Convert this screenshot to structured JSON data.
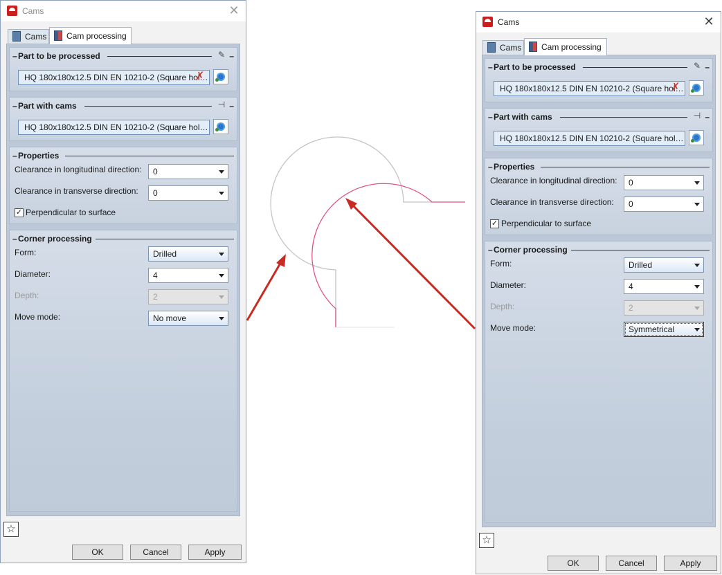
{
  "dialogs": [
    {
      "title": "Cams",
      "tabs": [
        "Cams",
        "Cam processing"
      ],
      "part_to_be_processed": {
        "title": "Part to be processed",
        "value": "HQ 180x180x12.5 DIN EN 10210-2 (Square hollo..."
      },
      "part_with_cams": {
        "title": "Part with cams",
        "value": "HQ 180x180x12.5 DIN EN 10210-2 (Square hollo..."
      },
      "properties": {
        "title": "Properties",
        "clearance_longitudinal_label": "Clearance in longitudinal direction:",
        "clearance_longitudinal": "0",
        "clearance_transverse_label": "Clearance in transverse direction:",
        "clearance_transverse": "0",
        "perpendicular_label": "Perpendicular to surface",
        "perpendicular_checked": "✓"
      },
      "corner": {
        "title": "Corner processing",
        "form_label": "Form:",
        "form": "Drilled",
        "diameter_label": "Diameter:",
        "diameter": "4",
        "depth_label": "Depth:",
        "depth": "2",
        "move_mode_label": "Move mode:",
        "move_mode": "No move"
      },
      "buttons": {
        "ok": "OK",
        "cancel": "Cancel",
        "apply": "Apply"
      }
    },
    {
      "title": "Cams",
      "tabs": [
        "Cams",
        "Cam processing"
      ],
      "part_to_be_processed": {
        "title": "Part to be processed",
        "value": "HQ 180x180x12.5 DIN EN 10210-2 (Square hollo..."
      },
      "part_with_cams": {
        "title": "Part with cams",
        "value": "HQ 180x180x12.5 DIN EN 10210-2 (Square hollo..."
      },
      "properties": {
        "title": "Properties",
        "clearance_longitudinal_label": "Clearance in longitudinal direction:",
        "clearance_longitudinal": "0",
        "clearance_transverse_label": "Clearance in transverse direction:",
        "clearance_transverse": "0",
        "perpendicular_label": "Perpendicular to surface",
        "perpendicular_checked": "✓"
      },
      "corner": {
        "title": "Corner processing",
        "form_label": "Form:",
        "form": "Drilled",
        "diameter_label": "Diameter:",
        "diameter": "4",
        "depth_label": "Depth:",
        "depth": "2",
        "move_mode_label": "Move mode:",
        "move_mode": "Symmetrical"
      },
      "buttons": {
        "ok": "OK",
        "cancel": "Cancel",
        "apply": "Apply"
      }
    }
  ],
  "icons": {
    "app": "app-logo-icon",
    "close": "close-icon",
    "pin": "pin-icon",
    "pin_horizontal": "pin-horizontal-icon",
    "remove": "remove-x-icon",
    "gear": "gear-icon",
    "favorite": "star-icon",
    "dropdown": "chevron-down-icon"
  },
  "colors": {
    "accent": "#2f73c9",
    "group_bg": "#c7d2df",
    "drawing_gray": "#c4c4c4",
    "drawing_pink": "#e0508a",
    "arrow_red": "#c82b22"
  }
}
